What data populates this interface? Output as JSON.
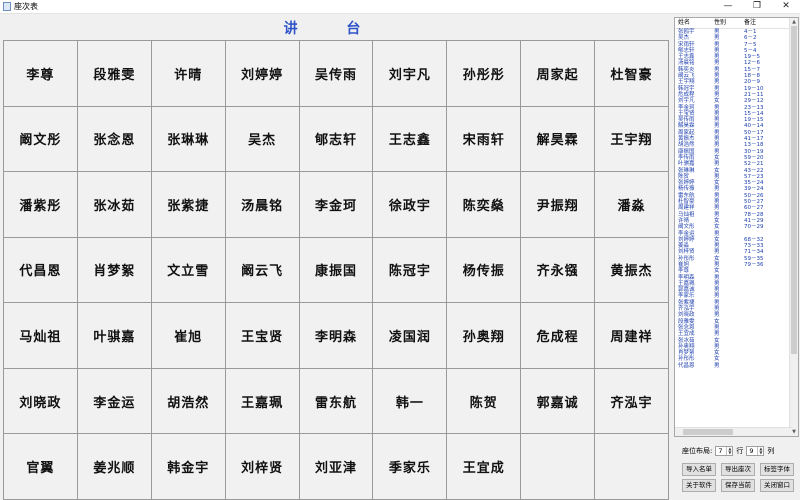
{
  "window": {
    "title": "座次表",
    "controls": {
      "minimize": "—",
      "maximize": "❐",
      "close": "✕"
    }
  },
  "podium": {
    "label": "讲 台"
  },
  "seating_grid": {
    "columns": 9,
    "rows": [
      [
        "李尊",
        "段雅雯",
        "许晴",
        "刘婷婷",
        "吴传雨",
        "刘宇凡",
        "孙彤彤",
        "周家起",
        "杜智豪"
      ],
      [
        "阚文彤",
        "张念恩",
        "张琳琳",
        "吴杰",
        "郇志轩",
        "王志鑫",
        "宋雨轩",
        "解昊霖",
        "王宇翔"
      ],
      [
        "潘紫彤",
        "张冰茹",
        "张紫捷",
        "汤晨铭",
        "李金珂",
        "徐政宇",
        "陈奕燊",
        "尹振翔",
        "潘淼"
      ],
      [
        "代昌恩",
        "肖梦絮",
        "文立雪",
        "阚云飞",
        "康振国",
        "陈冠宇",
        "杨传振",
        "齐永镪",
        "黄振杰"
      ],
      [
        "马灿祖",
        "叶骐嘉",
        "崔旭",
        "王宝贤",
        "李明森",
        "凌国润",
        "孙奥翔",
        "危成程",
        "周建祥"
      ],
      [
        "刘晓政",
        "李金运",
        "胡浩然",
        "王嘉珮",
        "雷东航",
        "韩一",
        "陈贺",
        "郭嘉诚",
        "齐泓宇"
      ],
      [
        "官翼",
        "姜兆顺",
        "韩金宇",
        "刘梓贤",
        "刘亚津",
        "季家乐",
        "王宜成",
        "",
        ""
      ]
    ]
  },
  "roster": {
    "headers": {
      "name": "姓名",
      "gender": "性别",
      "note": "备注"
    },
    "rows": [
      {
        "name": "张鸥宇",
        "gender": "男",
        "note": "4－1"
      },
      {
        "name": "吴杰",
        "gender": "男",
        "note": "6－2"
      },
      {
        "name": "宋雨轩",
        "gender": "男",
        "note": "7－5"
      },
      {
        "name": "郇志轩",
        "gender": "男",
        "note": "5－4"
      },
      {
        "name": "王志鑫",
        "gender": "男",
        "note": "19－5"
      },
      {
        "name": "汤晨铭",
        "gender": "男",
        "note": "12－6"
      },
      {
        "name": "韩奕炎",
        "gender": "男",
        "note": "15－7"
      },
      {
        "name": "阚云飞",
        "gender": "男",
        "note": "18－8"
      },
      {
        "name": "王宇翔",
        "gender": "男",
        "note": "20－9"
      },
      {
        "name": "韩冠宇",
        "gender": "男",
        "note": "19－10"
      },
      {
        "name": "危成程",
        "gender": "男",
        "note": "21－11"
      },
      {
        "name": "刘宇凡",
        "gender": "女",
        "note": "29－12"
      },
      {
        "name": "李金珂",
        "gender": "男",
        "note": "23－13"
      },
      {
        "name": "王宝贤",
        "gender": "男",
        "note": "15－14"
      },
      {
        "name": "吴传雨",
        "gender": "男",
        "note": "19－15"
      },
      {
        "name": "解昊霖",
        "gender": "男",
        "note": "40－14"
      },
      {
        "name": "周家起",
        "gender": "男",
        "note": "50－17"
      },
      {
        "name": "黄振杰",
        "gender": "男",
        "note": "41－17"
      },
      {
        "name": "胡浩然",
        "gender": "男",
        "note": "13－18"
      },
      {
        "name": "康振国",
        "gender": "男",
        "note": "30－19"
      },
      {
        "name": "李传雨",
        "gender": "女",
        "note": "59－20"
      },
      {
        "name": "叶骐嘉",
        "gender": "男",
        "note": "52－21"
      },
      {
        "name": "张琳琳",
        "gender": "女",
        "note": "43－22"
      },
      {
        "name": "陈贺",
        "gender": "男",
        "note": "57－23"
      },
      {
        "name": "张婷婷",
        "gender": "女",
        "note": "35－24"
      },
      {
        "name": "杨传振",
        "gender": "男",
        "note": "39－24"
      },
      {
        "name": "雷东航",
        "gender": "男",
        "note": "50－26"
      },
      {
        "name": "杜智豪",
        "gender": "男",
        "note": "50－27"
      },
      {
        "name": "周建祥",
        "gender": "男",
        "note": "60－27"
      },
      {
        "name": "马灿祖",
        "gender": "男",
        "note": "78－28"
      },
      {
        "name": "许晴",
        "gender": "女",
        "note": "41－29"
      },
      {
        "name": "阚文彤",
        "gender": "女",
        "note": "70－29"
      },
      {
        "name": "李金运",
        "gender": "男",
        "note": ""
      },
      {
        "name": "刘婷婷",
        "gender": "女",
        "note": "68－32"
      },
      {
        "name": "姜淼",
        "gender": "男",
        "note": "73－33"
      },
      {
        "name": "刘梓贤",
        "gender": "男",
        "note": "71－34"
      },
      {
        "name": "孙彤彤",
        "gender": "女",
        "note": "59－35"
      },
      {
        "name": "崔旭",
        "gender": "男",
        "note": "79－36"
      },
      {
        "name": "李尊",
        "gender": "女",
        "note": ""
      },
      {
        "name": "李明森",
        "gender": "男",
        "note": ""
      },
      {
        "name": "王嘉珮",
        "gender": "男",
        "note": ""
      },
      {
        "name": "郭嘉诚",
        "gender": "男",
        "note": ""
      },
      {
        "name": "李家乐",
        "gender": "男",
        "note": ""
      },
      {
        "name": "张紫捷",
        "gender": "男",
        "note": ""
      },
      {
        "name": "齐泓宇",
        "gender": "男",
        "note": ""
      },
      {
        "name": "刘晓政",
        "gender": "男",
        "note": ""
      },
      {
        "name": "段雅雯",
        "gender": "女",
        "note": ""
      },
      {
        "name": "张念恩",
        "gender": "男",
        "note": ""
      },
      {
        "name": "王宜成",
        "gender": "男",
        "note": ""
      },
      {
        "name": "张冰茹",
        "gender": "女",
        "note": ""
      },
      {
        "name": "孙奥翔",
        "gender": "男",
        "note": ""
      },
      {
        "name": "肖梦絮",
        "gender": "女",
        "note": ""
      },
      {
        "name": "孙彤彤",
        "gender": "女",
        "note": ""
      },
      {
        "name": "代昌恩",
        "gender": "男",
        "note": ""
      }
    ]
  },
  "layout_controls": {
    "label": "座位布局:",
    "rows_value": "7",
    "rows_unit": "行",
    "cols_value": "9",
    "cols_unit": "列"
  },
  "buttons": {
    "import": "导入名单",
    "export": "导出座次",
    "font": "标签字体",
    "about": "关于软件",
    "save": "保存当前",
    "close": "关闭窗口"
  },
  "colors": {
    "podium_text": "#2f54c8",
    "roster_text": "#1d3fae",
    "grid_line": "#9a9a9a",
    "seat_bg": "#f1f1f1"
  }
}
